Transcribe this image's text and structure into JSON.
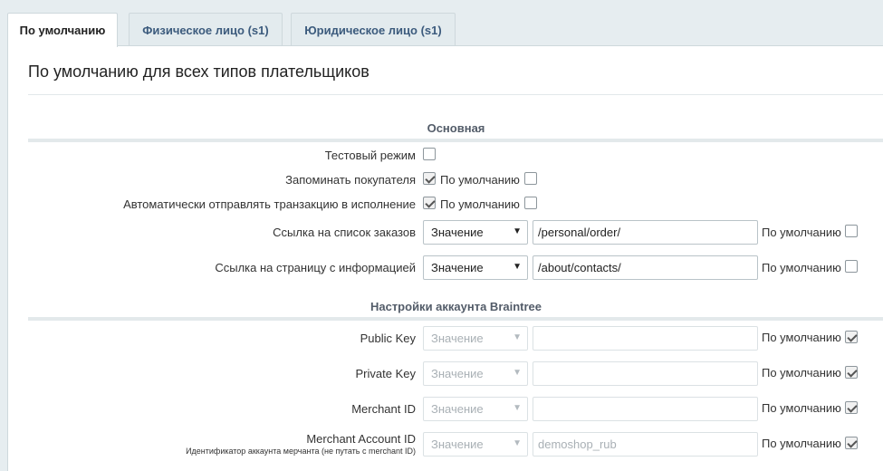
{
  "tabs": [
    {
      "label": "По умолчанию"
    },
    {
      "label": "Физическое лицо (s1)"
    },
    {
      "label": "Юридическое лицо (s1)"
    }
  ],
  "page_title": "По умолчанию для всех типов плательщиков",
  "sections": {
    "main": {
      "title": "Основная",
      "fields": {
        "test_mode": {
          "label": "Тестовый режим"
        },
        "remember_buyer": {
          "label": "Запоминать покупателя",
          "default_label": "По умолчанию"
        },
        "auto_submit": {
          "label": "Автоматически отправлять транзакцию в исполнение",
          "default_label": "По умолчанию"
        },
        "orders_link": {
          "label": "Ссылка на список заказов",
          "type_value": "Значение",
          "value": "/personal/order/",
          "default_label": "По умолчанию"
        },
        "info_link": {
          "label": "Ссылка на страницу с информацией",
          "type_value": "Значение",
          "value": "/about/contacts/",
          "default_label": "По умолчанию"
        }
      }
    },
    "braintree": {
      "title": "Настройки аккаунта Braintree",
      "fields": {
        "public_key": {
          "label": "Public Key",
          "type_value": "Значение",
          "value": "",
          "default_label": "По умолчанию"
        },
        "private_key": {
          "label": "Private Key",
          "type_value": "Значение",
          "value": "",
          "default_label": "По умолчанию"
        },
        "merchant_id": {
          "label": "Merchant ID",
          "type_value": "Значение",
          "value": "",
          "default_label": "По умолчанию"
        },
        "merchant_account_id": {
          "label": "Merchant Account ID",
          "hint": "Идентификатор аккаунта мерчанта (не путать с merchant ID)",
          "type_value": "Значение",
          "value": "demoshop_rub",
          "default_label": "По умолчанию"
        }
      }
    }
  },
  "icons": {
    "select_arrow": "▼"
  }
}
